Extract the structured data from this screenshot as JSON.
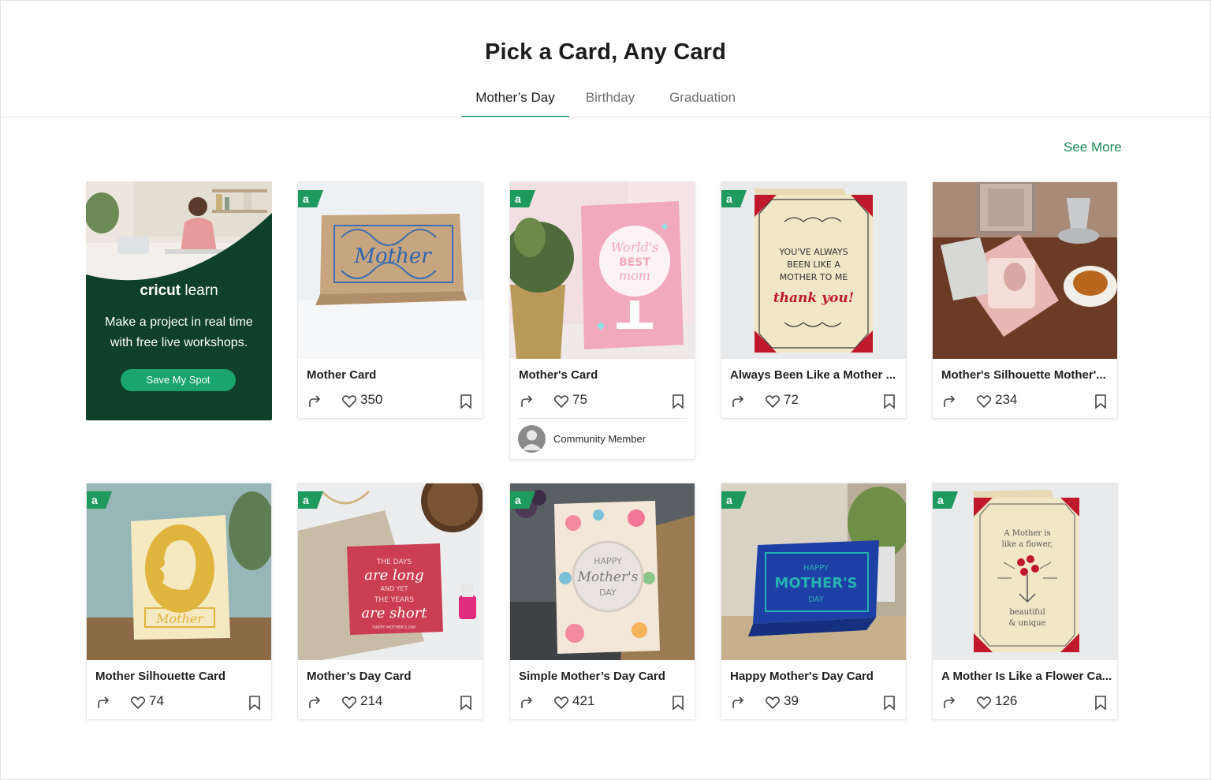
{
  "page": {
    "title": "Pick a Card, Any Card",
    "see_more": "See More"
  },
  "tabs": [
    {
      "label": "Mother’s Day",
      "active": true
    },
    {
      "label": "Birthday",
      "active": false
    },
    {
      "label": "Graduation",
      "active": false
    }
  ],
  "promo": {
    "logo_bold": "cricut",
    "logo_light": "learn",
    "line1": "Make a project in real time",
    "line2": "with free live workshops.",
    "button": "Save My Spot"
  },
  "cards": [
    {
      "title": "Mother Card",
      "likes": "350",
      "badge": true
    },
    {
      "title": "Mother's Card",
      "likes": "75",
      "badge": true,
      "member": "Community Member"
    },
    {
      "title": "Always Been Like a Mother ...",
      "likes": "72",
      "badge": true
    },
    {
      "title": "Mother's Silhouette Mother'...",
      "likes": "234",
      "badge": false
    },
    {
      "title": "Mother Silhouette Card",
      "likes": "74",
      "badge": true
    },
    {
      "title": "Mother’s Day Card",
      "likes": "214",
      "badge": true
    },
    {
      "title": "Simple Mother’s Day Card",
      "likes": "421",
      "badge": true
    },
    {
      "title": "Happy Mother's Day Card",
      "likes": "39",
      "badge": true
    },
    {
      "title": "A Mother Is Like a Flower Ca...",
      "likes": "126",
      "badge": true
    }
  ],
  "card_art_text": {
    "c0": "Mother",
    "c1_a": "World's",
    "c1_b": "BEST",
    "c1_c": "mom",
    "c2_a": "YOU'VE ALWAYS",
    "c2_b": "BEEN LIKE A",
    "c2_c": "MOTHER TO ME",
    "c2_d": "thank you!",
    "c4": "Mother",
    "c5_a": "THE DAYS",
    "c5_b": "are long",
    "c5_c": "AND YET",
    "c5_d": "THE YEARS",
    "c5_e": "are short",
    "c5_f": "HAPPY MOTHER'S DAY",
    "c6_a": "HAPPY",
    "c6_b": "Mother's",
    "c6_c": "DAY",
    "c7_a": "HAPPY",
    "c7_b": "MOTHER'S",
    "c7_c": "DAY",
    "c8_a": "A Mother is",
    "c8_b": "like a flower,",
    "c8_c": "beautiful",
    "c8_d": "& unique"
  },
  "colors": {
    "accent": "#1f8a5b",
    "promo_bg": "#0f4029",
    "promo_button": "#1aa66a"
  }
}
